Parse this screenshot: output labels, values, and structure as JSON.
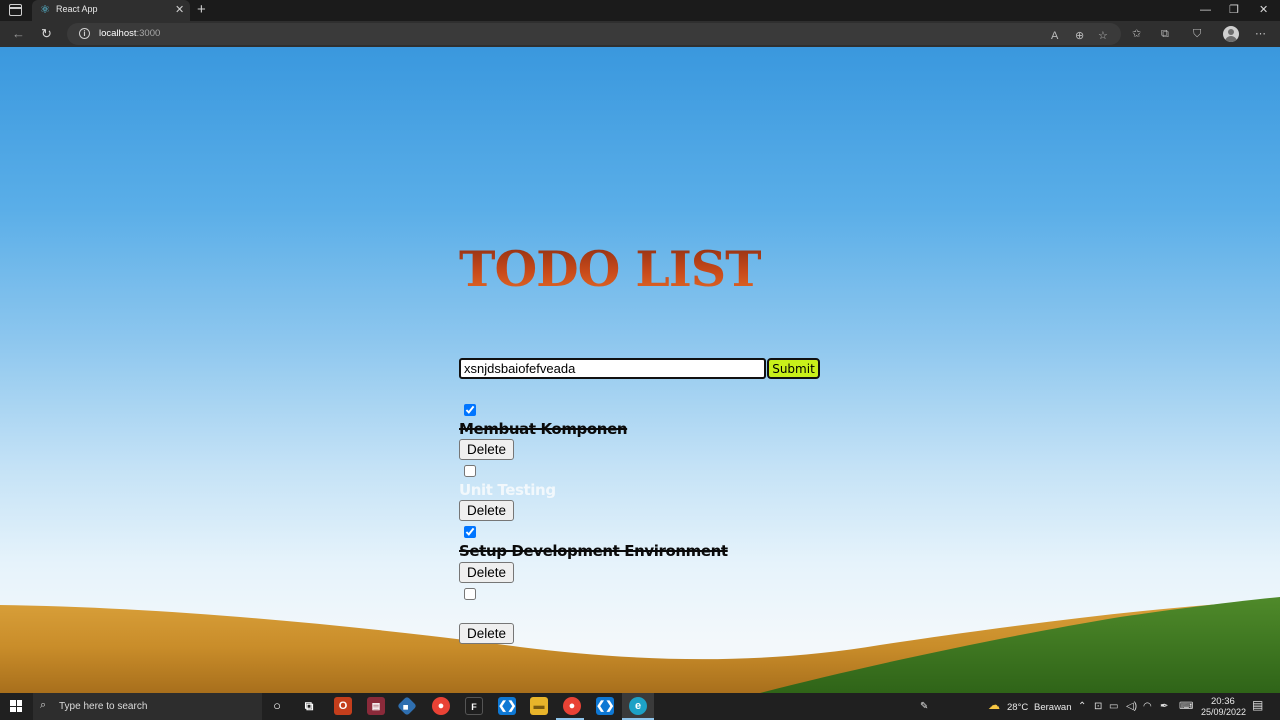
{
  "browser": {
    "tab_title": "React App",
    "tab_icon": "react-logo-icon",
    "url_host": "localhost",
    "url_port": ":3000"
  },
  "app": {
    "title": "TODO LIST",
    "input_value": "xsnjdsbaiofefveada",
    "submit_label": "Submit",
    "delete_label": "Delete",
    "todos": [
      {
        "text": "Membuat Komponen",
        "completed": true
      },
      {
        "text": "Unit Testing",
        "completed": false
      },
      {
        "text": "Setup Development Environment",
        "completed": true
      },
      {
        "text": "",
        "completed": false
      }
    ]
  },
  "taskbar": {
    "search_placeholder": "Type here to search",
    "weather": "28°C",
    "weather_desc": "Berawan",
    "time": "20:36",
    "date": "25/09/2022"
  },
  "colors": {
    "submit_bg": "#c8f01a",
    "title_color": "#b8431a",
    "pending_text": "#f2f8fc"
  }
}
